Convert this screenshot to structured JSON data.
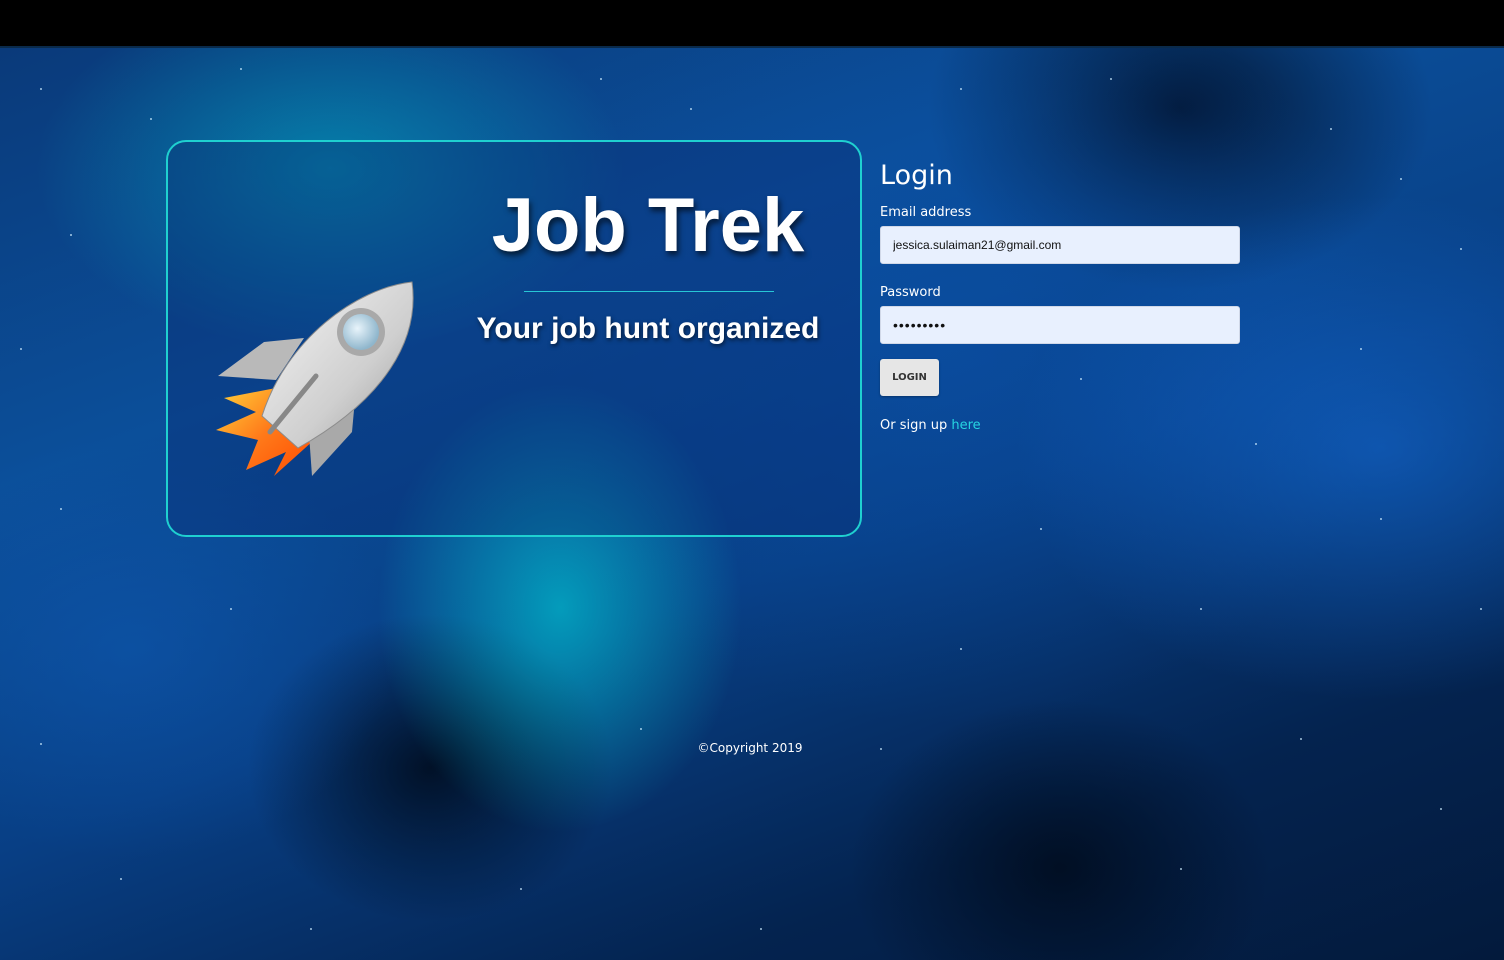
{
  "brand": {
    "title": "Job Trek",
    "tagline": "Your job hunt organized",
    "logo_icon": "rocket-icon"
  },
  "login": {
    "heading": "Login",
    "email_label": "Email address",
    "email_value": "jessica.sulaiman21@gmail.com",
    "password_label": "Password",
    "password_value": "password1",
    "button_label": "LOGIN",
    "signup_prefix": "Or sign up",
    "signup_link": "here"
  },
  "footer": {
    "copyright": "©Copyright 2019"
  },
  "colors": {
    "accent": "#26d4e2",
    "input_bg": "#e8f0fe",
    "button_bg": "#e6e6e6"
  }
}
